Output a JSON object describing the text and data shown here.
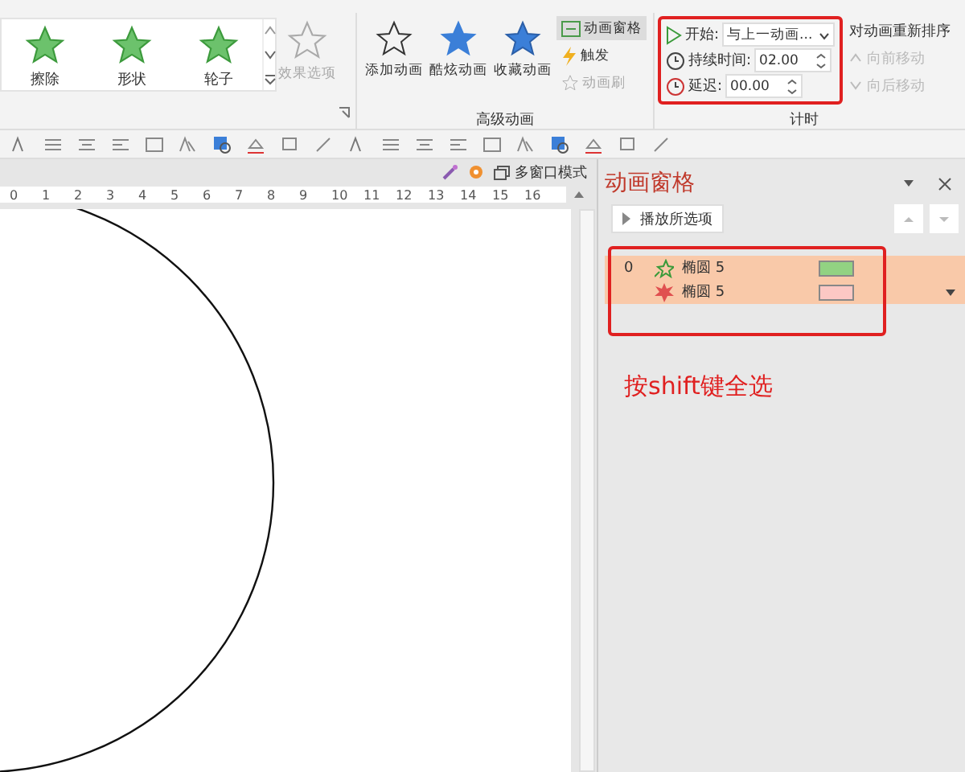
{
  "gallery": [
    {
      "label": "擦除"
    },
    {
      "label": "形状"
    },
    {
      "label": "轮子"
    }
  ],
  "effect_options": {
    "label": "效果选项",
    "disabled": true
  },
  "advanced_animation": {
    "group_label": "高级动画",
    "buttons": [
      "添加动画",
      "酷炫动画",
      "收藏动画"
    ],
    "small": [
      {
        "label": "动画窗格",
        "selected": true,
        "disabled": false
      },
      {
        "label": "触发",
        "selected": false,
        "disabled": false
      },
      {
        "label": "动画刷",
        "selected": false,
        "disabled": true
      }
    ]
  },
  "timing": {
    "group_label": "计时",
    "start_label": "开始:",
    "start_value": "与上一动画...",
    "duration_label": "持续时间:",
    "duration_value": "02.00",
    "delay_label": "延迟:",
    "delay_value": "00.00",
    "reorder_title": "对动画重新排序",
    "move_buttons": [
      {
        "label": "向前移动",
        "disabled": true
      },
      {
        "label": "向后移动",
        "disabled": true
      }
    ]
  },
  "view_bar": {
    "multi_window": "多窗口模式"
  },
  "ruler": [
    "0",
    "1",
    "2",
    "3",
    "4",
    "5",
    "6",
    "7",
    "8",
    "9",
    "10",
    "11",
    "12",
    "13",
    "14",
    "15",
    "16"
  ],
  "pane": {
    "title": "动画窗格",
    "play_button": "播放所选项",
    "items": [
      {
        "index": "0",
        "name": "椭圆 5",
        "kind": "entrance",
        "color": "#92d282",
        "selected": true
      },
      {
        "name": "椭圆 5",
        "kind": "emphasis",
        "color": "#fcc8c4",
        "selected": true
      }
    ],
    "note": "按shift键全选"
  }
}
